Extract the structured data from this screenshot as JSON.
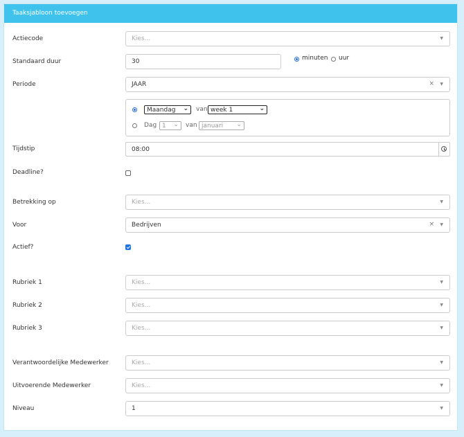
{
  "title": "Taaksjabloon toevoegen",
  "fields": {
    "actiecode": {
      "label": "Actiecode",
      "placeholder": "Kies..."
    },
    "standaard_duur": {
      "label": "Standaard duur",
      "value": "30",
      "unit_options": [
        "minuten",
        "uur"
      ],
      "selected_unit": "minuten"
    },
    "periode": {
      "label": "Periode",
      "value": "JAAR"
    },
    "periode_detail": {
      "option1": {
        "day_value": "Maandag",
        "van": "van",
        "week_value": "week 1"
      },
      "option2": {
        "label": "Dag",
        "day_value": "1",
        "van": "van",
        "month_value": "januari"
      }
    },
    "tijdstip": {
      "label": "Tijdstip",
      "value": "08:00"
    },
    "deadline": {
      "label": "Deadline?",
      "checked": false
    },
    "betrekking_op": {
      "label": "Betrekking op",
      "placeholder": "Kies..."
    },
    "voor": {
      "label": "Voor",
      "value": "Bedrijven"
    },
    "actief": {
      "label": "Actief?",
      "checked": true
    },
    "rubriek1": {
      "label": "Rubriek 1",
      "placeholder": "Kies..."
    },
    "rubriek2": {
      "label": "Rubriek 2",
      "placeholder": "Kies..."
    },
    "rubriek3": {
      "label": "Rubriek 3",
      "placeholder": "Kies..."
    },
    "verantwoordelijke": {
      "label": "Verantwoordelijke Medewerker",
      "placeholder": "Kies..."
    },
    "uitvoerende": {
      "label": "Uitvoerende Medewerker",
      "placeholder": "Kies..."
    },
    "niveau": {
      "label": "Niveau",
      "value": "1"
    }
  },
  "icons": {
    "caret": "caret-down-icon",
    "clear": "clear-x-icon",
    "clock": "clock-icon"
  },
  "colors": {
    "header": "#3fc3ec",
    "background": "#d6effa",
    "accent": "#1a73e8"
  }
}
